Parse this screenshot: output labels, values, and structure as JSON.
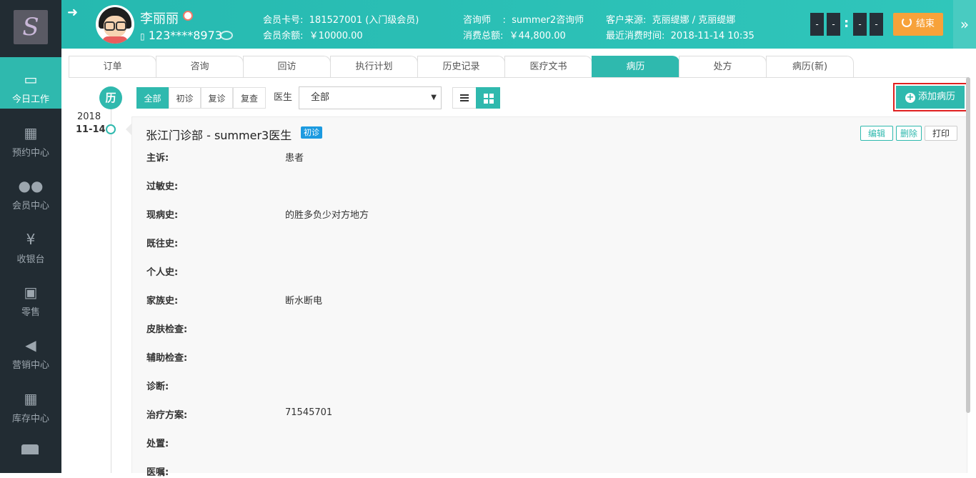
{
  "sidebar": {
    "logo_text": "S",
    "items": [
      {
        "label": "今日工作",
        "icon": "laptop-icon"
      },
      {
        "label": "预约中心",
        "icon": "calendar-icon"
      },
      {
        "label": "会员中心",
        "icon": "users-icon"
      },
      {
        "label": "收银台",
        "icon": "yen-icon"
      },
      {
        "label": "零售",
        "icon": "cart-icon"
      },
      {
        "label": "营销中心",
        "icon": "megaphone-icon"
      },
      {
        "label": "库存中心",
        "icon": "grid-icon"
      }
    ]
  },
  "header": {
    "customer_name": "李丽丽",
    "phone": "123****8973",
    "card_no_label": "会员卡号:",
    "card_no": "181527001 (入门级会员)",
    "balance_label": "会员余额:",
    "balance": "￥10000.00",
    "consultant_label": "咨询师    :",
    "consultant": "summer2咨询师",
    "total_spend_label": "消费总额:",
    "total_spend": "￥44,800.00",
    "source_label": "客户来源:",
    "source": "克丽缇娜 / 克丽缇娜",
    "last_spend_label": "最近消费时间:",
    "last_spend": "2018-11-14 10:35",
    "timer": [
      "-",
      "-",
      "-",
      "-"
    ],
    "timer_sep": ":",
    "end_label": "结束"
  },
  "tabs": [
    {
      "label": "订单",
      "active": false
    },
    {
      "label": "咨询",
      "active": false
    },
    {
      "label": "回访",
      "active": false
    },
    {
      "label": "执行计划",
      "active": false
    },
    {
      "label": "历史记录",
      "active": false
    },
    {
      "label": "医疗文书",
      "active": false
    },
    {
      "label": "病历",
      "active": true
    },
    {
      "label": "处方",
      "active": false
    },
    {
      "label": "病历(新)",
      "active": false
    }
  ],
  "toolbar": {
    "timeline_icon": "历",
    "filters": [
      {
        "label": "全部",
        "active": true
      },
      {
        "label": "初诊",
        "active": false
      },
      {
        "label": "复诊",
        "active": false
      },
      {
        "label": "复查",
        "active": false
      }
    ],
    "doctor_label": "医生",
    "doctor_select": "全部",
    "add_label": "添加病历"
  },
  "timeline": {
    "year": "2018",
    "date": "11-14"
  },
  "record": {
    "title": "张江门诊部 - summer3医生",
    "badge": "初诊",
    "edit_label": "编辑",
    "delete_label": "删除",
    "print_label": "打印",
    "fields": [
      {
        "label": "主诉:",
        "value": "患者"
      },
      {
        "label": "过敏史:",
        "value": ""
      },
      {
        "label": "现病史:",
        "value": "的胜多负少对方地方"
      },
      {
        "label": "既往史:",
        "value": ""
      },
      {
        "label": "个人史:",
        "value": ""
      },
      {
        "label": "家族史:",
        "value": "断水断电"
      },
      {
        "label": "皮肤检查:",
        "value": ""
      },
      {
        "label": "辅助检查:",
        "value": ""
      },
      {
        "label": "诊断:",
        "value": ""
      },
      {
        "label": "治疗方案:",
        "value": "71545701"
      },
      {
        "label": "处置:",
        "value": ""
      },
      {
        "label": "医嘱:",
        "value": ""
      }
    ]
  },
  "colors": {
    "accent": "#2fb9ae",
    "sidebar": "#222c33",
    "end_button": "#f7a23a",
    "badge": "#1b9ae0",
    "highlight": "#e02020"
  }
}
